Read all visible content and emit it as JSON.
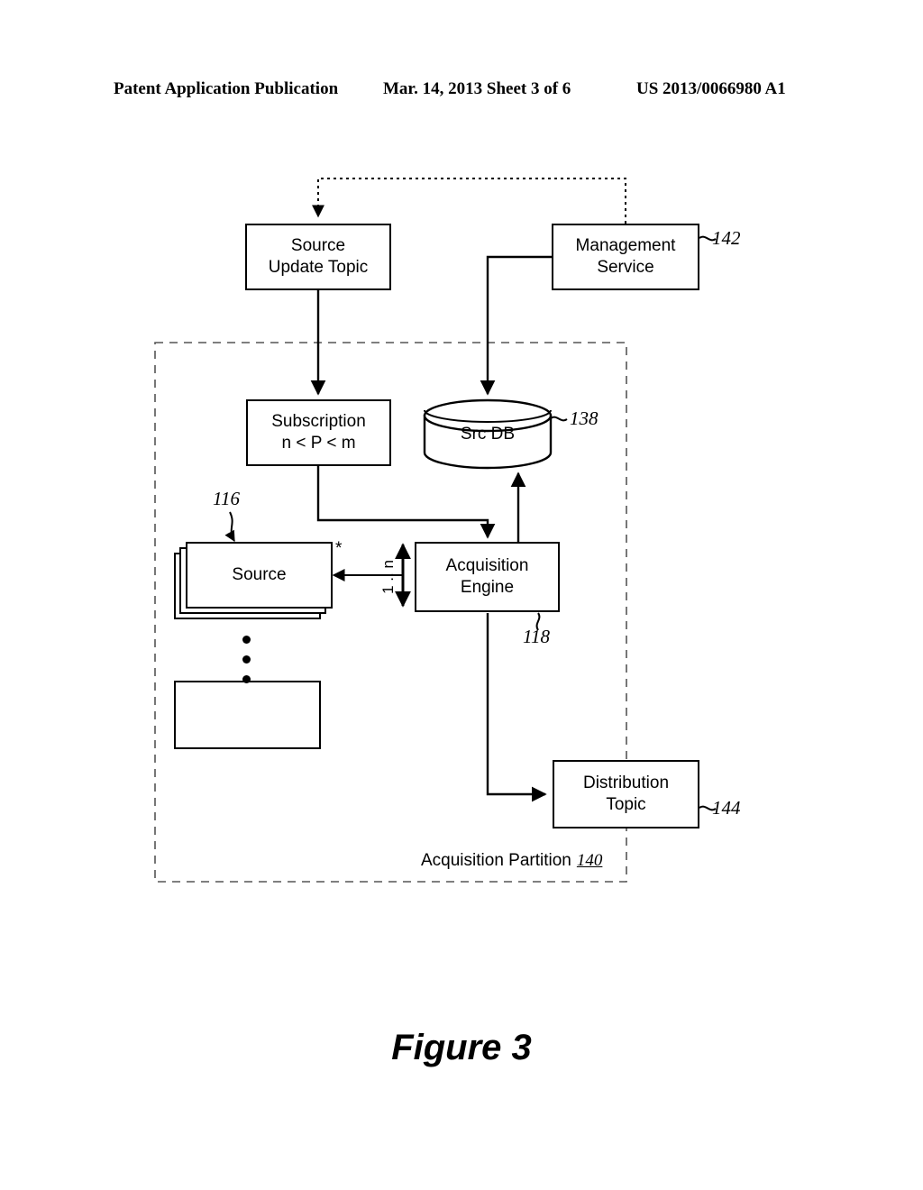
{
  "header": {
    "left": "Patent Application Publication",
    "middle": "Mar. 14, 2013  Sheet 3 of 6",
    "right": "US 2013/0066980 A1"
  },
  "figure": {
    "caption": "Figure 3"
  },
  "diagram": {
    "partition": {
      "label": "Acquisition Partition",
      "ref": "140"
    },
    "nodes": [
      {
        "id": "source_update_topic",
        "label_line1": "Source",
        "label_line2": "Update Topic",
        "ref": ""
      },
      {
        "id": "management_service",
        "label_line1": "Management",
        "label_line2": "Service",
        "ref": "142"
      },
      {
        "id": "subscription",
        "label_line1": "Subscription",
        "label_line2": "n < P < m",
        "ref": ""
      },
      {
        "id": "src_db",
        "label_line1": "Src DB",
        "label_line2": "",
        "ref": "138"
      },
      {
        "id": "source",
        "label_line1": "Source",
        "label_line2": "",
        "ref": "116"
      },
      {
        "id": "acquisition_engine",
        "label_line1": "Acquisition",
        "label_line2": "Engine",
        "ref": "118"
      },
      {
        "id": "empty_source",
        "label_line1": "",
        "label_line2": "",
        "ref": ""
      },
      {
        "id": "distribution_topic",
        "label_line1": "Distribution",
        "label_line2": "Topic",
        "ref": "144"
      }
    ],
    "multiplicity": {
      "source_star": "*",
      "engine_range": "1 .. n"
    }
  }
}
